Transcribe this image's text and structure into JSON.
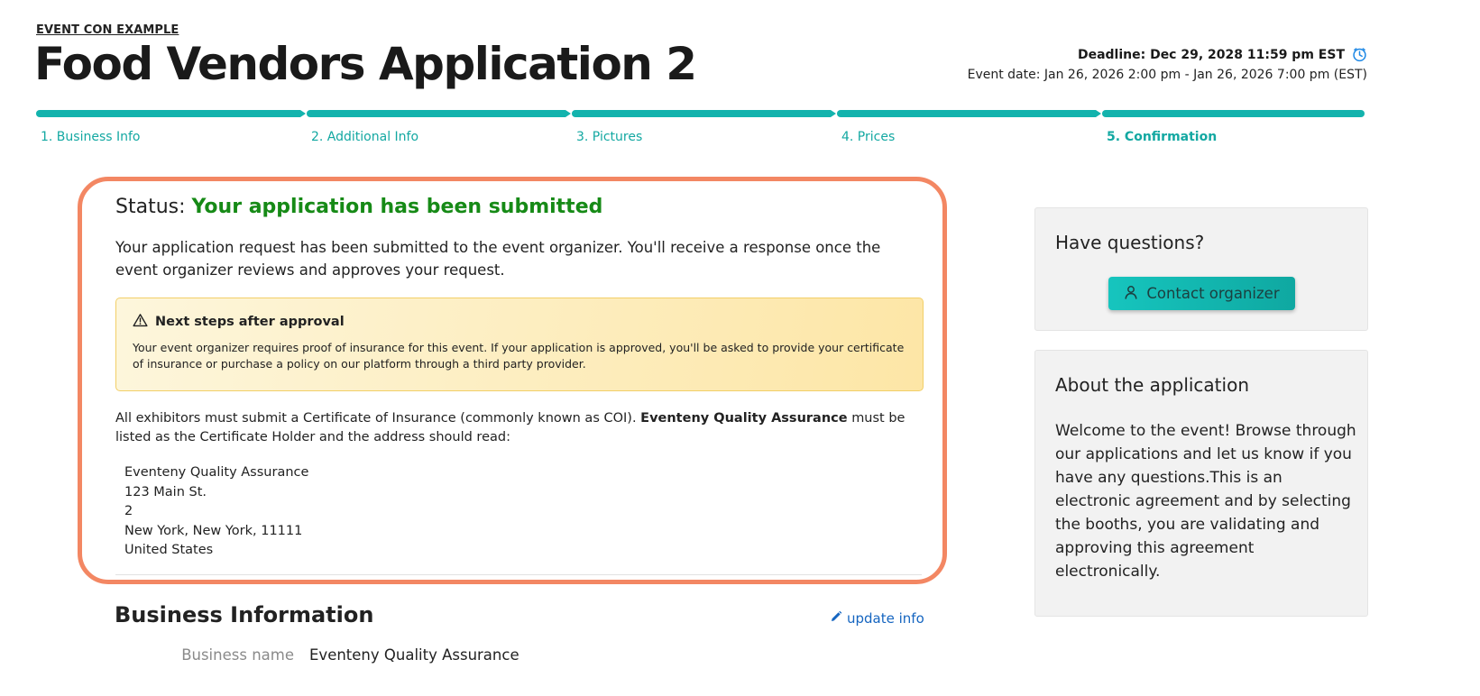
{
  "header": {
    "event_label": "EVENT CON EXAMPLE",
    "title": "Food Vendors Application 2",
    "deadline": "Deadline: Dec 29, 2028 11:59 pm EST",
    "event_date": "Event date: Jan 26, 2026 2:00 pm - Jan 26, 2026 7:00 pm (EST)",
    "deadline_icon": "clock-icon"
  },
  "steps": {
    "items": [
      {
        "label": "1. Business Info"
      },
      {
        "label": "2. Additional Info"
      },
      {
        "label": "3. Pictures"
      },
      {
        "label": "4. Prices"
      },
      {
        "label": "5. Confirmation"
      }
    ],
    "active_index": 4,
    "accent_color": "#13b3ad"
  },
  "status": {
    "prefix": "Status:",
    "value": "Your application has been submitted",
    "value_color": "#168a16",
    "description": "Your application request has been submitted to the event organizer. You'll receive a response once the event organizer reviews and approves your request.",
    "next_steps": {
      "icon": "warning-icon",
      "title": "Next steps after approval",
      "body": "Your event organizer requires proof of insurance for this event. If your application is approved, you'll be asked to provide your certificate of insurance or purchase a policy on our platform through a third party provider."
    },
    "coi": {
      "before": "All exhibitors must submit a Certificate of Insurance (commonly known as COI).",
      "holder": "Eventeny Quality Assurance",
      "after": "must be listed as the Certificate Holder and the address should read:"
    },
    "address": [
      "Eventeny Quality Assurance",
      "123 Main St.",
      "2",
      "New York, New York, 11111",
      "United States"
    ],
    "highlight_color": "#f38763"
  },
  "business_info": {
    "title": "Business Information",
    "update_label": "update info",
    "update_icon": "pencil-icon",
    "rows": [
      {
        "key": "Business name",
        "value": "Eventeny Quality Assurance"
      }
    ]
  },
  "sidebar": {
    "questions_title": "Have questions?",
    "contact_label": "Contact organizer",
    "contact_icon": "user-icon",
    "about_title": "About the application",
    "about_text": "Welcome to the event! Browse through our applications and let us know if you have any questions.This is an electronic agreement and by selecting the booths, you are validating and approving this agreement electronically."
  }
}
